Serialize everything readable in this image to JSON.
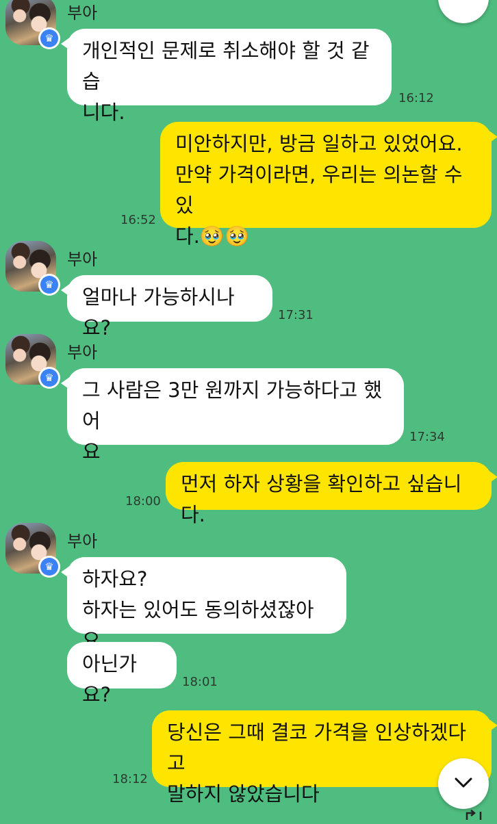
{
  "chat": {
    "messages": [
      {
        "sender": "부아",
        "text": "개인적인 문제로 취소해야 할 것 같습\n니다.",
        "time": "16:12"
      },
      {
        "text": "미안하지만, 방금 일하고 있었어요.\n만약 가격이라면, 우리는 의논할 수 있\n다.🥹🥹",
        "time": "16:52"
      },
      {
        "sender": "부아",
        "text": "얼마나 가능하시나요?",
        "time": "17:31"
      },
      {
        "sender": "부아",
        "text": "그 사람은 3만 원까지 가능하다고 했어\n요",
        "time": "17:34"
      },
      {
        "text": "먼저 하자 상황을 확인하고 싶습니다.",
        "time": "18:00"
      },
      {
        "sender": "부아",
        "text": "하자요?\n하자는 있어도 동의하셨잖아요."
      },
      {
        "text": "아닌가요?",
        "time": "18:01"
      },
      {
        "text": "당신은 그때 결코 가격을 인상하겠다고\n말하지 않았습니다",
        "time": "18:12"
      }
    ]
  },
  "colors": {
    "background": "#4fbd7f",
    "incoming_bubble": "#ffffff",
    "outgoing_bubble": "#fee500",
    "badge": "#3b82f6"
  },
  "icons": {
    "badge": "crown-icon",
    "scroll_down": "chevron-down-icon",
    "top_button": "chevron-right-icon",
    "reply": "reply-arrow-icon"
  }
}
